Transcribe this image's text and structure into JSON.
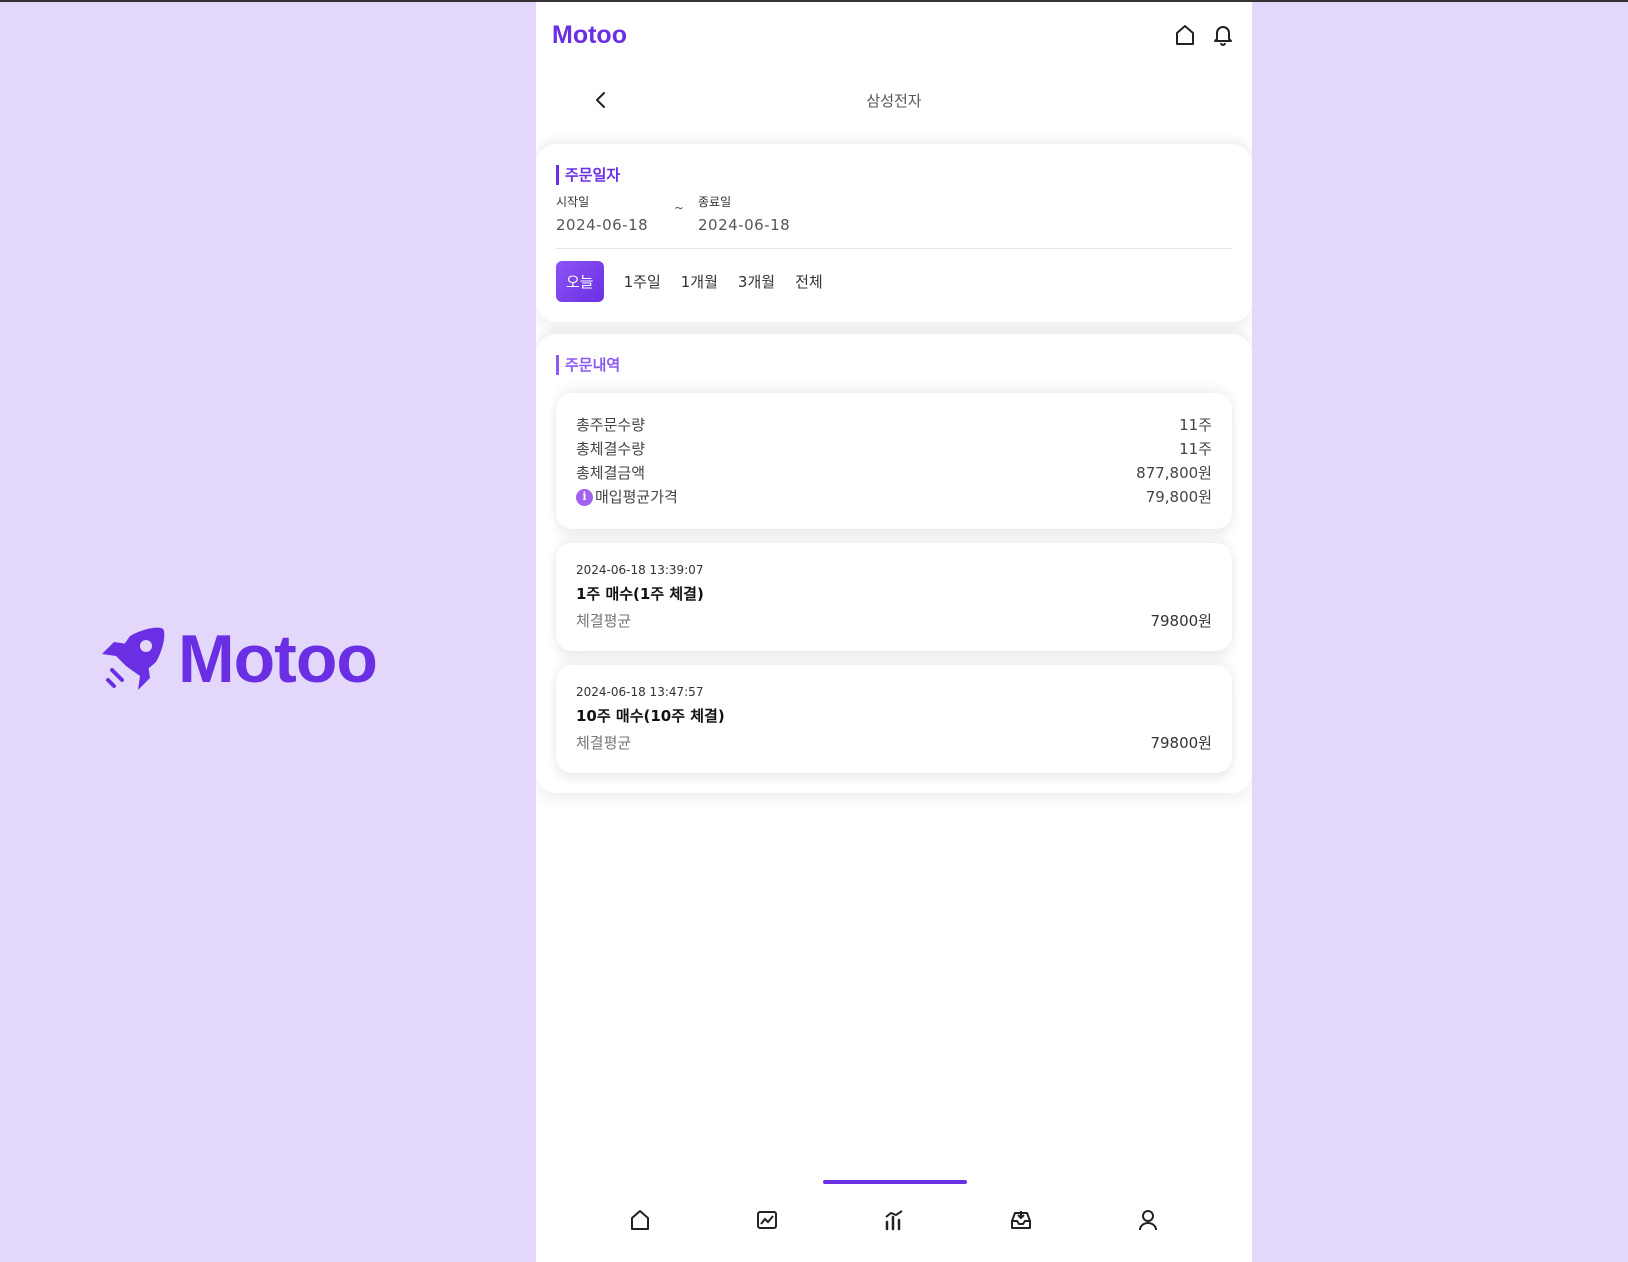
{
  "brand": {
    "name": "Motoo",
    "icon": "rocket-icon",
    "color": "#6a2fe3"
  },
  "app": {
    "title": "Motoo",
    "header_icons": [
      "home-icon",
      "bell-icon"
    ]
  },
  "subheader": {
    "title": "삼성전자",
    "back_icon": "chevron-left-icon"
  },
  "order_date": {
    "section_title": "주문일자",
    "start_label": "시작일",
    "start_value": "2024-06-18",
    "separator": "~",
    "end_label": "종료일",
    "end_value": "2024-06-18",
    "periods": [
      {
        "label": "오늘",
        "active": true
      },
      {
        "label": "1주일",
        "active": false
      },
      {
        "label": "1개월",
        "active": false
      },
      {
        "label": "3개월",
        "active": false
      },
      {
        "label": "전체",
        "active": false
      }
    ]
  },
  "order_history": {
    "section_title": "주문내역",
    "summary": [
      {
        "label": "총주문수량",
        "value": "11주"
      },
      {
        "label": "총체결수량",
        "value": "11주"
      },
      {
        "label": "총체결금액",
        "value": "877,800원"
      },
      {
        "label": "매입평균가격",
        "value": "79,800원",
        "info_icon": "info-icon"
      }
    ],
    "transactions": [
      {
        "datetime": "2024-06-18 13:39:07",
        "title": "1주 매수(1주 체결)",
        "label": "체결평균",
        "value": "79800원"
      },
      {
        "datetime": "2024-06-18 13:47:57",
        "title": "10주 매수(10주 체결)",
        "label": "체결평균",
        "value": "79800원"
      }
    ]
  },
  "bottom_nav": {
    "items": [
      "home-icon",
      "chart-icon",
      "bar-chart-icon",
      "inbox-icon",
      "user-icon"
    ],
    "active_index": 2
  }
}
